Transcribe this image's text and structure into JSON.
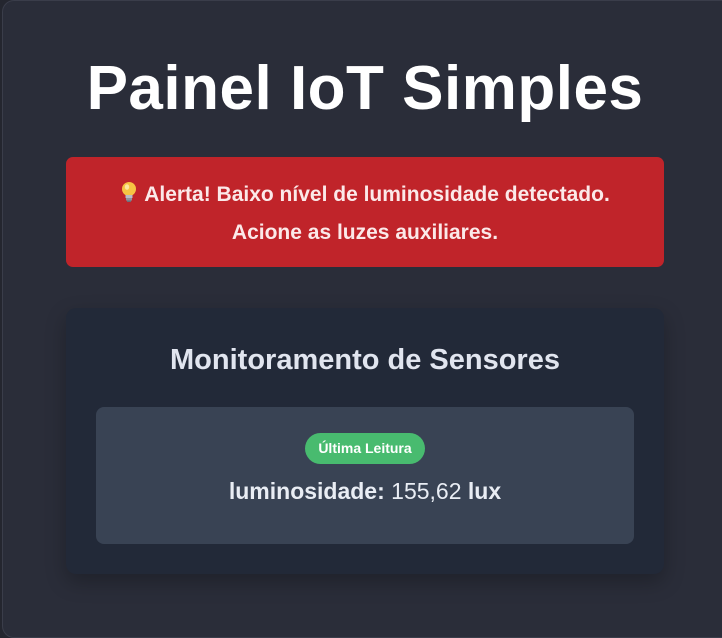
{
  "page": {
    "title": "Painel IoT Simples"
  },
  "alert": {
    "icon": "lightbulb-icon",
    "line1": "Alerta! Baixo nível de luminosidade detectado.",
    "line2": "Acione as luzes auxiliares.",
    "color": "#c0242a"
  },
  "sensors": {
    "title": "Monitoramento de Sensores",
    "badge": "Última Leitura",
    "badge_color": "#48bb6f",
    "label": "luminosidade:",
    "value": "155,62",
    "unit": "lux"
  }
}
